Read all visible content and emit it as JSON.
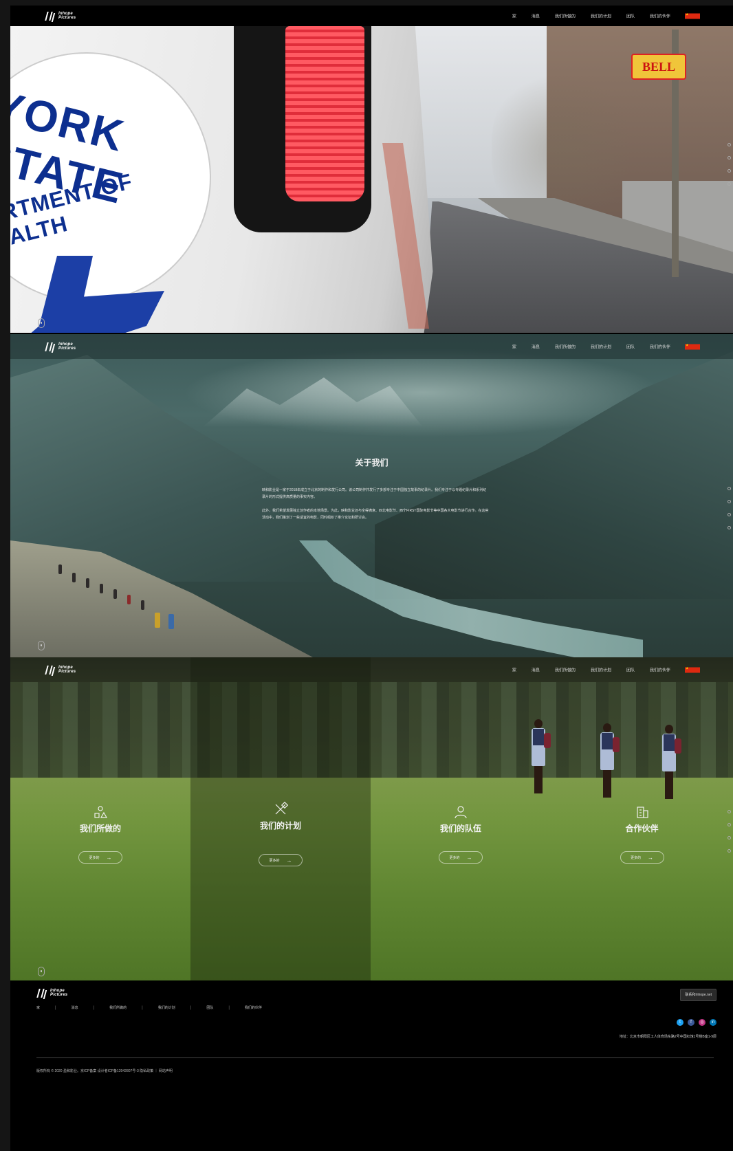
{
  "brand": {
    "name_line1": "Inhope",
    "name_line2": "Pictures"
  },
  "nav": {
    "items": [
      "家",
      "消息",
      "我们所做的",
      "我们的计划",
      "团队",
      "我们的伙伴"
    ],
    "language_flag": "china-flag-icon"
  },
  "hero": {
    "seal_line1": "YORK STATE",
    "seal_line2": "PARTMENT OF HEALTH",
    "sign_text": "BELL"
  },
  "about": {
    "title": "关于我们",
    "paragraph1": "映和影业是一家于2018年成立于北京的制作和发行公司。该公司制作并发行了多部专注于中国独立故事的纪录片。我们专注于以专题纪录片和系列纪录片的形式提供高质量的事实内容。",
    "paragraph2": "此外，我们希望发展独立创作者的本地场景。为此，映和影业还与全得满意、四北电影节、西宁FIRST国际电影节等中国各大电影节进行合作。在这些活动中，我们策划了一些适宜的电影，同时组织了推介论坛和研讨会。"
  },
  "panels": [
    {
      "icon": "shapes-icon",
      "title": "我们所做的",
      "button": "更多的"
    },
    {
      "icon": "pencil-ruler-icon",
      "title": "我们的计划",
      "button": "更多的"
    },
    {
      "icon": "person-icon",
      "title": "我们的队伍",
      "button": "更多的"
    },
    {
      "icon": "building-icon",
      "title": "合作伙伴",
      "button": "更多的"
    }
  ],
  "footer": {
    "cta": "联系和Inhope.net",
    "links": [
      "家",
      "消息",
      "我们所做的",
      "我们的计划",
      "团队",
      "我们的伙伴"
    ],
    "address": "地址：北京市朝阳区工人体育场东路2号中国红馆1号楼B座1-9层",
    "copyright": "版权所有 © 2020 盈和影业。京ICP备案 设计者ICP备12042807号-3    隐私政策 ｜ 网站声明"
  },
  "colors": {
    "page_bg": "#000000",
    "accent_flag": "#de2910",
    "social_twitter": "#1da1f2",
    "social_facebook": "#3b5998",
    "social_instagram": "#c13584",
    "social_linkedin": "#0077b5"
  }
}
